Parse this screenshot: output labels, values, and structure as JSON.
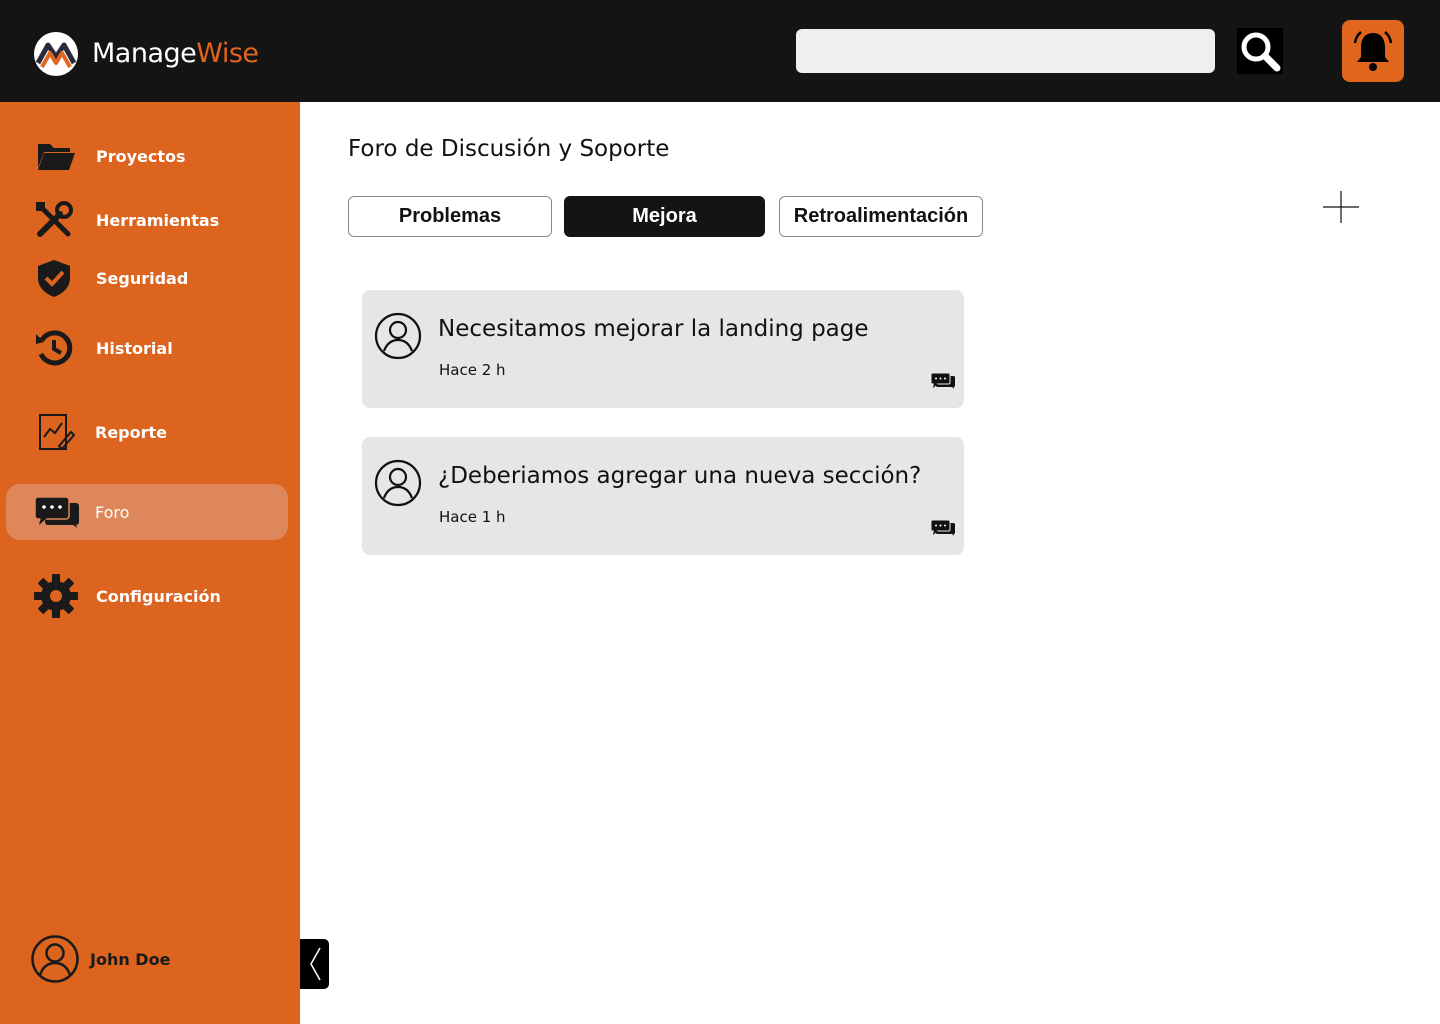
{
  "header": {
    "brand_part1": "Manage",
    "brand_part2": "Wise",
    "search_placeholder": "",
    "brand_colors": {
      "primary": "#dc641e",
      "dark": "#141414"
    }
  },
  "sidebar": {
    "items": [
      {
        "label": "Proyectos",
        "icon": "folder-icon"
      },
      {
        "label": "Herramientas",
        "icon": "tools-icon"
      },
      {
        "label": "Seguridad",
        "icon": "shield-icon"
      },
      {
        "label": "Historial",
        "icon": "history-icon"
      },
      {
        "label": "Reporte",
        "icon": "report-icon"
      },
      {
        "label": "Foro",
        "icon": "chat-icon",
        "active": true
      },
      {
        "label": "Configuración",
        "icon": "gear-icon"
      }
    ],
    "user": {
      "name": "John Doe"
    }
  },
  "main": {
    "title": "Foro de Discusión y Soporte",
    "tabs": [
      {
        "label": "Problemas"
      },
      {
        "label": "Mejora",
        "active": true
      },
      {
        "label": "Retroalimentación"
      }
    ],
    "posts": [
      {
        "title": "Necesitamos mejorar la landing page",
        "time": "Hace 2 h"
      },
      {
        "title": "¿Deberiamos agregar una nueva sección?",
        "time": "Hace 1 h"
      }
    ]
  }
}
